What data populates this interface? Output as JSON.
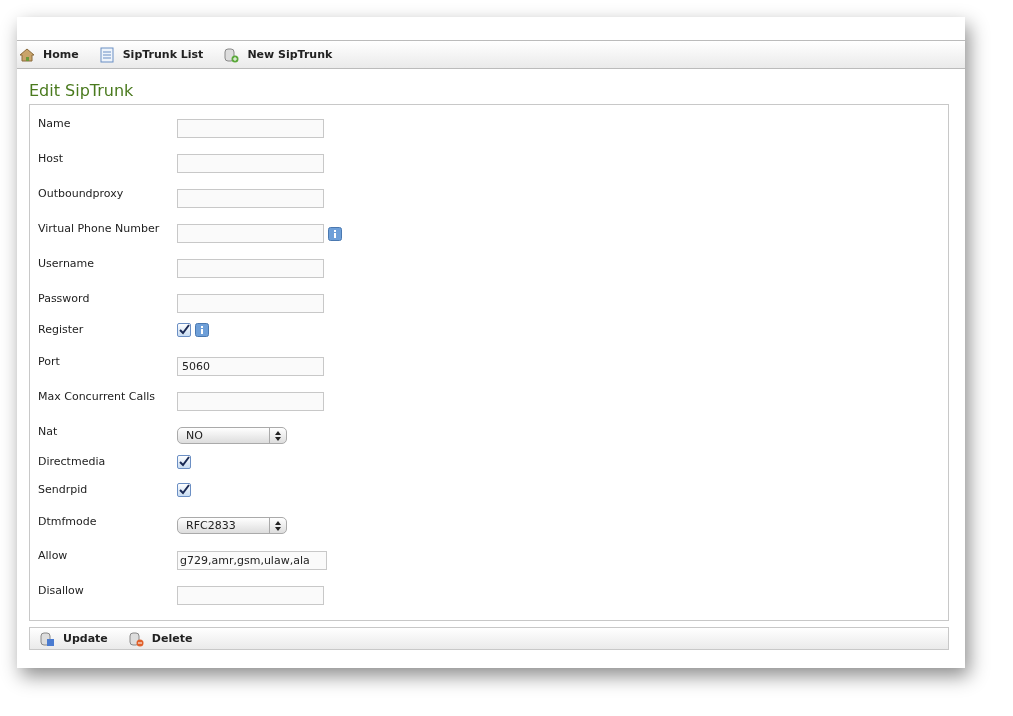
{
  "nav": [
    {
      "label": "Home"
    },
    {
      "label": "SipTrunk List"
    },
    {
      "label": "New SipTrunk"
    }
  ],
  "title": "Edit SipTrunk",
  "fields": [
    {
      "label": "Name",
      "kind": "text"
    },
    {
      "label": "Host",
      "kind": "text"
    },
    {
      "label": "Outboundproxy",
      "kind": "text"
    },
    {
      "label": "Virtual Phone Number",
      "kind": "text",
      "info": true
    },
    {
      "label": "Username",
      "kind": "text"
    },
    {
      "label": "Password",
      "kind": "text"
    },
    {
      "label": "Register",
      "kind": "checkbox",
      "checked": true,
      "info": true
    },
    {
      "label": "Port",
      "kind": "text",
      "value": "5060"
    },
    {
      "label": "Max Concurrent Calls",
      "kind": "text"
    },
    {
      "label": "Nat",
      "kind": "select",
      "value": "NO"
    },
    {
      "label": "Directmedia",
      "kind": "checkbox",
      "checked": true
    },
    {
      "label": "Sendrpid",
      "kind": "checkbox",
      "checked": true
    },
    {
      "label": "Dtmfmode",
      "kind": "select",
      "value": "RFC2833"
    },
    {
      "label": "Allow",
      "kind": "text",
      "value": "g729,amr,gsm,ulaw,ala"
    },
    {
      "label": "Disallow",
      "kind": "text"
    }
  ],
  "actions": [
    {
      "label": "Update"
    },
    {
      "label": "Delete"
    }
  ]
}
